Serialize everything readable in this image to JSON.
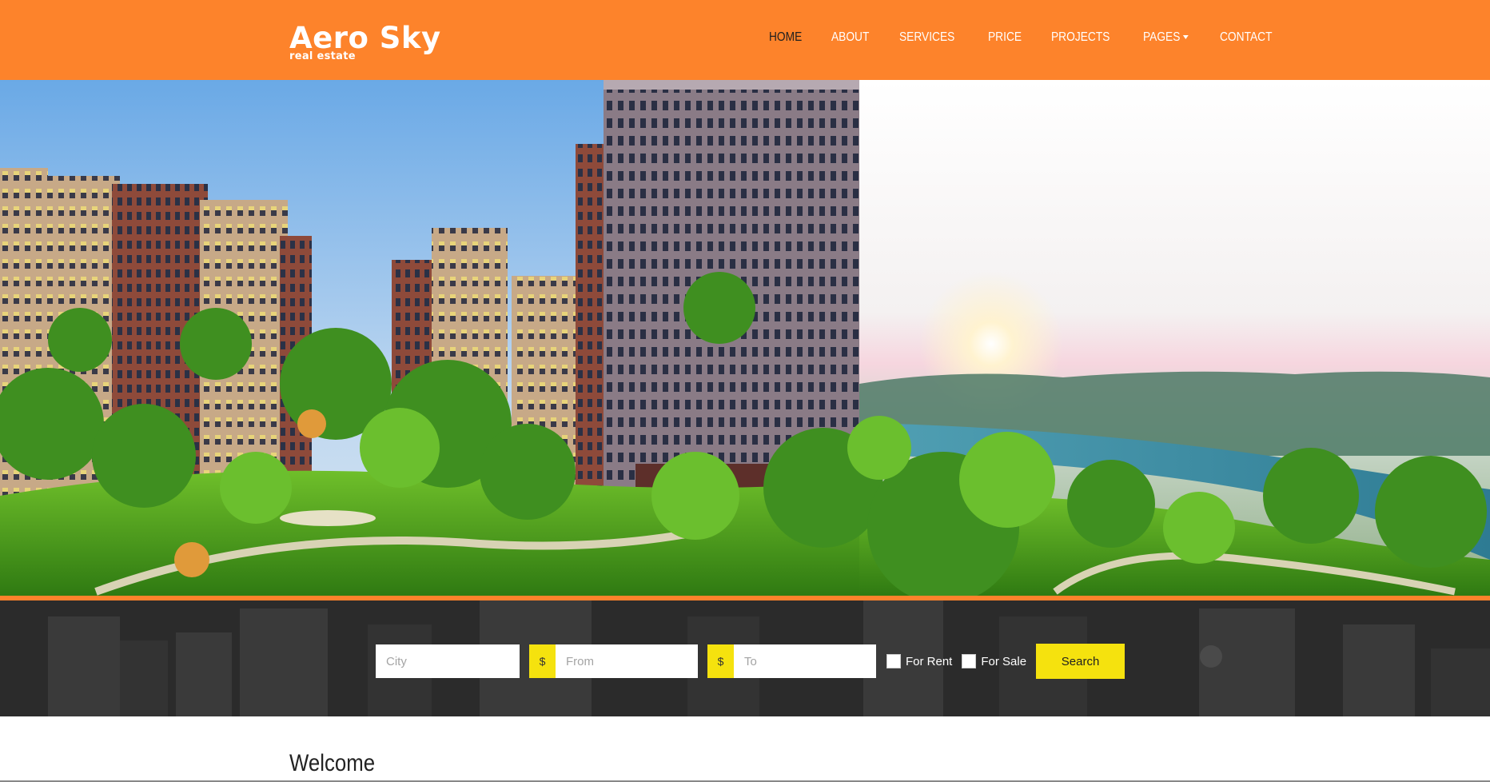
{
  "brand": {
    "title": "Aero Sky",
    "subtitle": "real estate",
    "accent_color": "#fd832b",
    "highlight_color": "#f5e20e"
  },
  "nav": {
    "items": [
      {
        "label": "HOME",
        "active": true
      },
      {
        "label": "ABOUT"
      },
      {
        "label": "SERVICES"
      },
      {
        "label": "PRICE"
      },
      {
        "label": "PROJECTS"
      },
      {
        "label": "PAGES",
        "dropdown": true
      },
      {
        "label": "CONTACT"
      }
    ]
  },
  "hero": {
    "image_icon": "city-landscape-image"
  },
  "search": {
    "city_placeholder": "City",
    "currency_symbol": "$",
    "from_placeholder": "From",
    "to_placeholder": "To",
    "for_rent_label": "For Rent",
    "for_sale_label": "For Sale",
    "search_label": "Search"
  },
  "main": {
    "welcome_heading": "Welcome"
  }
}
